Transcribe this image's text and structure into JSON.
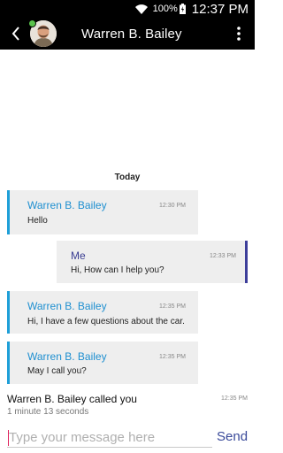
{
  "status_bar": {
    "battery_percent": "100%",
    "time": "12:37 PM"
  },
  "header": {
    "title": "Warren B. Bailey",
    "online": true
  },
  "chat": {
    "date_separator": "Today",
    "messages": [
      {
        "direction": "in",
        "sender": "Warren B. Bailey",
        "time": "12:30 PM",
        "text": "Hello"
      },
      {
        "direction": "out",
        "sender": "Me",
        "time": "12:33 PM",
        "text": "Hi, How can I help you?"
      },
      {
        "direction": "in",
        "sender": "Warren B. Bailey",
        "time": "12:35 PM",
        "text": "Hi, I have a few questions about the car."
      },
      {
        "direction": "in",
        "sender": "Warren B. Bailey",
        "time": "12:35 PM",
        "text": "May I call you?"
      }
    ],
    "call_log": {
      "text": "Warren B. Bailey called you",
      "duration": "1 minute 13 seconds",
      "time": "12:35 PM"
    }
  },
  "composer": {
    "placeholder": "Type your message here",
    "value": "",
    "send_label": "Send"
  },
  "colors": {
    "incoming_accent": "#1e9fd8",
    "outgoing_accent": "#3d3e9a",
    "bubble_bg": "#eeeeee",
    "presence": "#5ac24c"
  }
}
